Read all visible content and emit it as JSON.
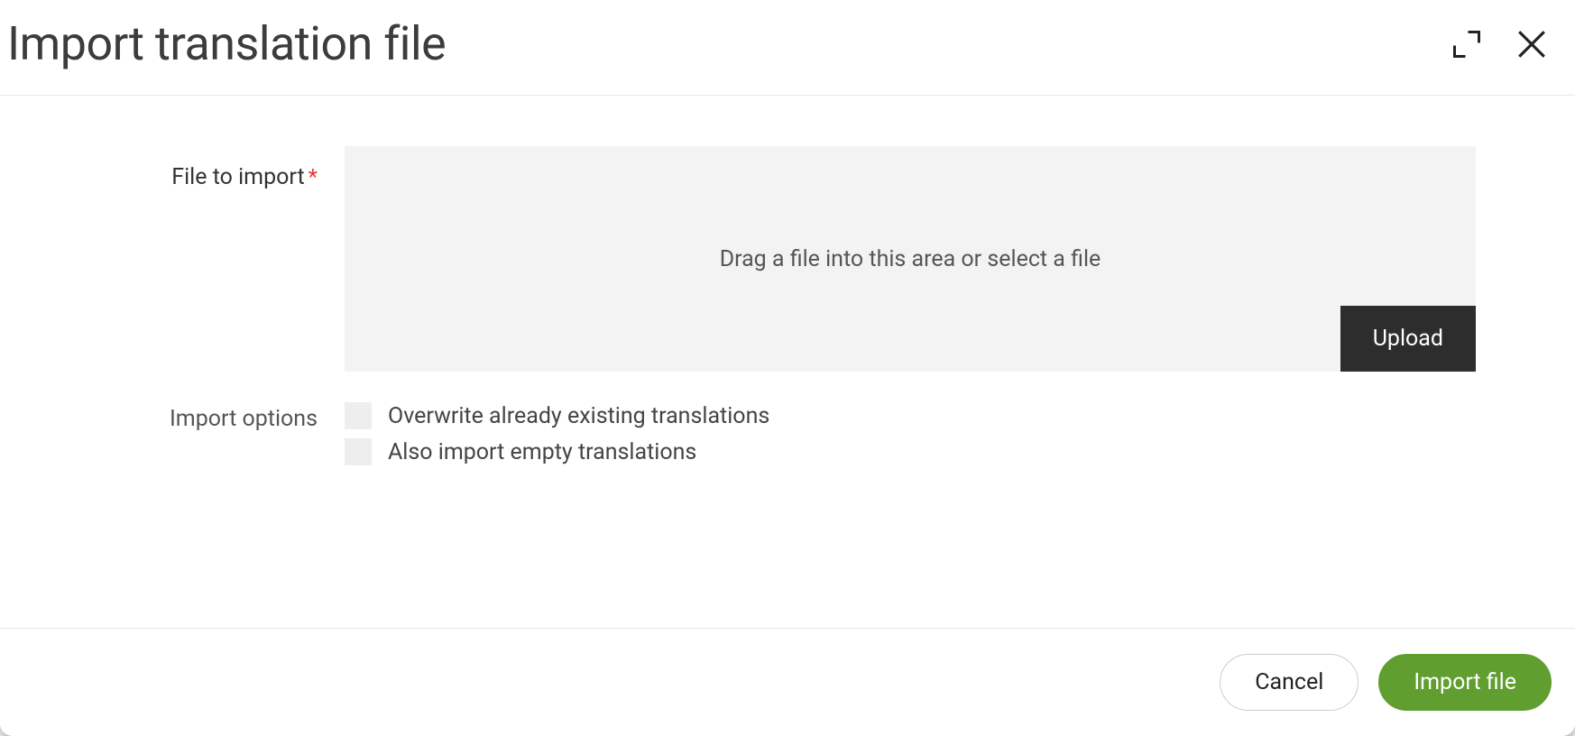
{
  "dialog": {
    "title": "Import translation file"
  },
  "form": {
    "file_label": "File to import",
    "dropzone_text": "Drag a file into this area or select a file",
    "upload_label": "Upload",
    "options_label": "Import options",
    "options": [
      {
        "label": "Overwrite already existing translations",
        "checked": false
      },
      {
        "label": "Also import empty translations",
        "checked": false
      }
    ]
  },
  "footer": {
    "cancel_label": "Cancel",
    "submit_label": "Import file"
  }
}
